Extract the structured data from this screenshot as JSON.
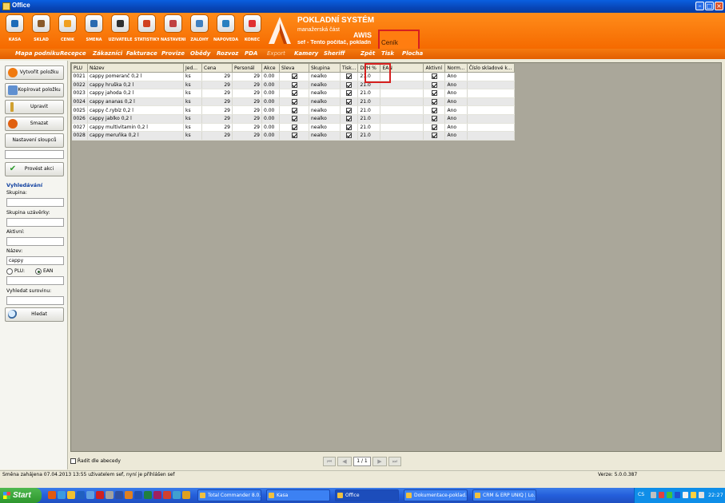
{
  "window": {
    "title": "Office"
  },
  "modules": [
    {
      "label": "KASA",
      "icon": "cash-register-icon",
      "color": "#1e6bb8"
    },
    {
      "label": "SKLAD",
      "icon": "warehouse-icon",
      "color": "#8a5a2a"
    },
    {
      "label": "CENÍK",
      "icon": "price-list-icon",
      "color": "#f0a020"
    },
    {
      "label": "SMĚNA",
      "icon": "shift-icon",
      "color": "#2a6ab0"
    },
    {
      "label": "UŽIVATELÉ",
      "icon": "users-icon",
      "color": "#303030"
    },
    {
      "label": "STATISTIKY",
      "icon": "statistics-icon",
      "color": "#d04020"
    },
    {
      "label": "NASTAVENÍ",
      "icon": "settings-icon",
      "color": "#c04040"
    },
    {
      "label": "ZÁLOHY",
      "icon": "backup-icon",
      "color": "#4080c0"
    },
    {
      "label": "NÁPOVĚDA",
      "icon": "help-icon",
      "color": "#2a80c0"
    },
    {
      "label": "KONEC",
      "icon": "exit-icon",
      "color": "#e03030"
    }
  ],
  "brand": {
    "title": "POKLADNÍ SYSTÉM",
    "subtitle": "manažerská část",
    "product": "AWIS",
    "user_line": "sef - Tento počítač, pokladn"
  },
  "section_title": "Ceník",
  "menu": [
    {
      "label": "Mapa podniku",
      "enabled": true
    },
    {
      "label": "Recepce",
      "enabled": true
    },
    {
      "label": "Zákazníci",
      "enabled": true
    },
    {
      "label": "Fakturace",
      "enabled": true
    },
    {
      "label": "Provize",
      "enabled": true
    },
    {
      "label": "Obědy",
      "enabled": true
    },
    {
      "label": "Rozvoz",
      "enabled": true
    },
    {
      "label": "PDA",
      "enabled": true
    },
    {
      "label": "Export",
      "enabled": false
    },
    {
      "label": "Kamery",
      "enabled": true
    },
    {
      "label": "Sheriff",
      "enabled": true
    },
    {
      "label": "Zpět",
      "enabled": true
    },
    {
      "label": "Tisk",
      "enabled": true
    },
    {
      "label": "Plocha",
      "enabled": true
    }
  ],
  "sidebar": {
    "create_label": "Vytvořit položku",
    "copy_label": "Kopírovat položku",
    "edit_label": "Upravit",
    "delete_label": "Smazat",
    "columns_label": "Nastavení sloupců",
    "action_label": "Provést akci",
    "search_heading": "Vyhledávání",
    "group_label": "Skupina:",
    "closure_group_label": "Skupina uzávěrky:",
    "active_label": "Aktivní:",
    "name_label": "Název:",
    "name_value": "cappy",
    "plu_label": "PLU:",
    "ean_label": "EAN",
    "search_mode": "EAN",
    "material_label": "Vyhledat surovinu:",
    "search_button": "Hledat"
  },
  "table": {
    "columns": [
      "PLU",
      "Název",
      "Jed...",
      "Cena",
      "Personál",
      "Akce",
      "Sleva",
      "Skupina",
      "Tisk...",
      "DPH %",
      "EAN",
      "Aktivní",
      "Norm...",
      "Číslo skladové k..."
    ],
    "rows": [
      {
        "plu": "0021",
        "name": "cappy pomeranč 0,2 l",
        "unit": "ks",
        "price": "29",
        "staff": "29",
        "action": "0.00",
        "discount": true,
        "group": "nealko",
        "print": true,
        "vat": "21.0",
        "ean": "",
        "active": true,
        "norm": "Ano",
        "stock": ""
      },
      {
        "plu": "0022",
        "name": "cappy hruška 0,2 l",
        "unit": "ks",
        "price": "29",
        "staff": "29",
        "action": "0.00",
        "discount": true,
        "group": "nealko",
        "print": true,
        "vat": "21.0",
        "ean": "",
        "active": true,
        "norm": "Ano",
        "stock": ""
      },
      {
        "plu": "0023",
        "name": "cappy jahoda 0,2 l",
        "unit": "ks",
        "price": "29",
        "staff": "29",
        "action": "0.00",
        "discount": true,
        "group": "nealko",
        "print": true,
        "vat": "21.0",
        "ean": "",
        "active": true,
        "norm": "Ano",
        "stock": ""
      },
      {
        "plu": "0024",
        "name": "cappy ananas 0,2 l",
        "unit": "ks",
        "price": "29",
        "staff": "29",
        "action": "0.00",
        "discount": true,
        "group": "nealko",
        "print": true,
        "vat": "21.0",
        "ean": "",
        "active": true,
        "norm": "Ano",
        "stock": ""
      },
      {
        "plu": "0025",
        "name": "cappy č.rybíz 0,2 l",
        "unit": "ks",
        "price": "29",
        "staff": "29",
        "action": "0.00",
        "discount": true,
        "group": "nealko",
        "print": true,
        "vat": "21.0",
        "ean": "",
        "active": true,
        "norm": "Ano",
        "stock": ""
      },
      {
        "plu": "0026",
        "name": "cappy jablko 0,2 l",
        "unit": "ks",
        "price": "29",
        "staff": "29",
        "action": "0.00",
        "discount": true,
        "group": "nealko",
        "print": true,
        "vat": "21.0",
        "ean": "",
        "active": true,
        "norm": "Ano",
        "stock": ""
      },
      {
        "plu": "0027",
        "name": "cappy multivitamin 0,2 l",
        "unit": "ks",
        "price": "29",
        "staff": "29",
        "action": "0.00",
        "discount": true,
        "group": "nealko",
        "print": true,
        "vat": "21.0",
        "ean": "",
        "active": true,
        "norm": "Ano",
        "stock": ""
      },
      {
        "plu": "0028",
        "name": "cappy meruňka 0,2 l",
        "unit": "ks",
        "price": "29",
        "staff": "29",
        "action": "0.00",
        "discount": true,
        "group": "nealko",
        "print": true,
        "vat": "21.0",
        "ean": "",
        "active": true,
        "norm": "Ano",
        "stock": ""
      }
    ]
  },
  "footer": {
    "sort_label": "Řadit dle abecedy",
    "sort_checked": false,
    "page_text": "1 / 1"
  },
  "status": {
    "message": "Směna zahájena 07.04.2013 13:55 uživatelem sef, nyní je přihlášen sef",
    "version": "Verze: 5.0.0.387"
  },
  "taskbar": {
    "start_label": "Start",
    "tasks": [
      {
        "label": "Total Commander 8.0...",
        "active": false
      },
      {
        "label": "Kasa",
        "active": false
      },
      {
        "label": "Office",
        "active": true
      },
      {
        "label": "Dokumentace-poklad...",
        "active": false
      },
      {
        "label": "CRM & ERP UNIQ | Lo...",
        "active": false
      }
    ],
    "language": "CS",
    "clock": "22:27"
  }
}
